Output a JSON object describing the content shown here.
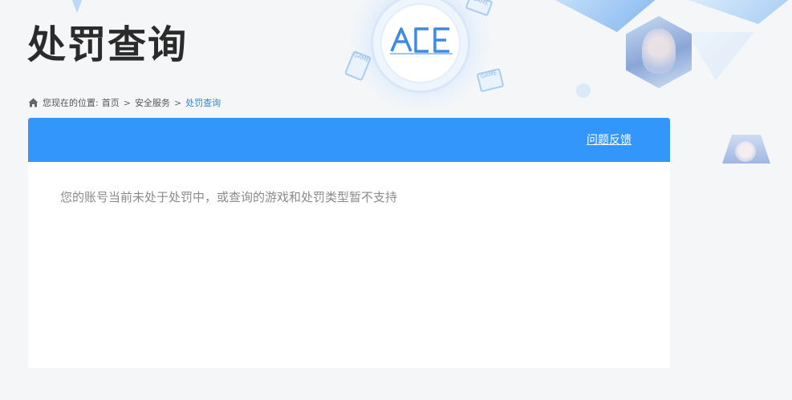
{
  "page": {
    "title": "处罚查询"
  },
  "logo": {
    "text": "ACE"
  },
  "decor": {
    "tags": [
      "GAME",
      "GAME",
      "GAME"
    ]
  },
  "breadcrumb": {
    "prefix": "您现在的位置:",
    "items": [
      "首页",
      "安全服务"
    ],
    "separator": ">",
    "current": "处罚查询"
  },
  "panel": {
    "feedback_label": "问题反馈",
    "status_message": "您的账号当前未处于处罚中，或查询的游戏和处罚类型暂不支持"
  },
  "colors": {
    "accent": "#3396fb",
    "breadcrumb_current": "#2f86d6",
    "title": "#2b2b2b",
    "message": "#8a8a8a"
  }
}
